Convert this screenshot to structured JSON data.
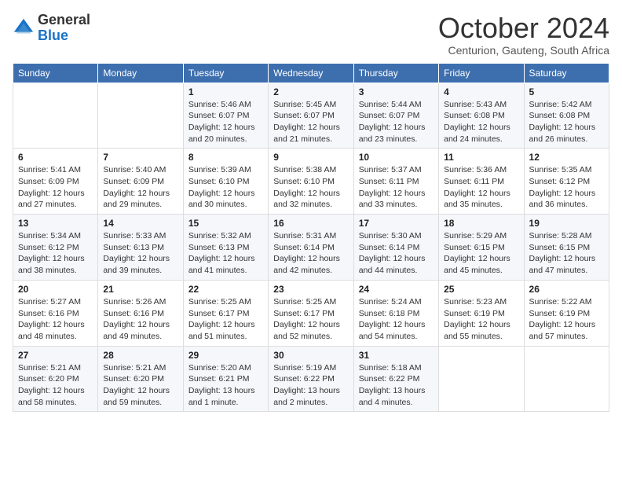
{
  "header": {
    "logo_general": "General",
    "logo_blue": "Blue",
    "month_title": "October 2024",
    "subtitle": "Centurion, Gauteng, South Africa"
  },
  "days_of_week": [
    "Sunday",
    "Monday",
    "Tuesday",
    "Wednesday",
    "Thursday",
    "Friday",
    "Saturday"
  ],
  "weeks": [
    [
      {
        "day": "",
        "sunrise": "",
        "sunset": "",
        "daylight": ""
      },
      {
        "day": "",
        "sunrise": "",
        "sunset": "",
        "daylight": ""
      },
      {
        "day": "1",
        "sunrise": "Sunrise: 5:46 AM",
        "sunset": "Sunset: 6:07 PM",
        "daylight": "Daylight: 12 hours and 20 minutes."
      },
      {
        "day": "2",
        "sunrise": "Sunrise: 5:45 AM",
        "sunset": "Sunset: 6:07 PM",
        "daylight": "Daylight: 12 hours and 21 minutes."
      },
      {
        "day": "3",
        "sunrise": "Sunrise: 5:44 AM",
        "sunset": "Sunset: 6:07 PM",
        "daylight": "Daylight: 12 hours and 23 minutes."
      },
      {
        "day": "4",
        "sunrise": "Sunrise: 5:43 AM",
        "sunset": "Sunset: 6:08 PM",
        "daylight": "Daylight: 12 hours and 24 minutes."
      },
      {
        "day": "5",
        "sunrise": "Sunrise: 5:42 AM",
        "sunset": "Sunset: 6:08 PM",
        "daylight": "Daylight: 12 hours and 26 minutes."
      }
    ],
    [
      {
        "day": "6",
        "sunrise": "Sunrise: 5:41 AM",
        "sunset": "Sunset: 6:09 PM",
        "daylight": "Daylight: 12 hours and 27 minutes."
      },
      {
        "day": "7",
        "sunrise": "Sunrise: 5:40 AM",
        "sunset": "Sunset: 6:09 PM",
        "daylight": "Daylight: 12 hours and 29 minutes."
      },
      {
        "day": "8",
        "sunrise": "Sunrise: 5:39 AM",
        "sunset": "Sunset: 6:10 PM",
        "daylight": "Daylight: 12 hours and 30 minutes."
      },
      {
        "day": "9",
        "sunrise": "Sunrise: 5:38 AM",
        "sunset": "Sunset: 6:10 PM",
        "daylight": "Daylight: 12 hours and 32 minutes."
      },
      {
        "day": "10",
        "sunrise": "Sunrise: 5:37 AM",
        "sunset": "Sunset: 6:11 PM",
        "daylight": "Daylight: 12 hours and 33 minutes."
      },
      {
        "day": "11",
        "sunrise": "Sunrise: 5:36 AM",
        "sunset": "Sunset: 6:11 PM",
        "daylight": "Daylight: 12 hours and 35 minutes."
      },
      {
        "day": "12",
        "sunrise": "Sunrise: 5:35 AM",
        "sunset": "Sunset: 6:12 PM",
        "daylight": "Daylight: 12 hours and 36 minutes."
      }
    ],
    [
      {
        "day": "13",
        "sunrise": "Sunrise: 5:34 AM",
        "sunset": "Sunset: 6:12 PM",
        "daylight": "Daylight: 12 hours and 38 minutes."
      },
      {
        "day": "14",
        "sunrise": "Sunrise: 5:33 AM",
        "sunset": "Sunset: 6:13 PM",
        "daylight": "Daylight: 12 hours and 39 minutes."
      },
      {
        "day": "15",
        "sunrise": "Sunrise: 5:32 AM",
        "sunset": "Sunset: 6:13 PM",
        "daylight": "Daylight: 12 hours and 41 minutes."
      },
      {
        "day": "16",
        "sunrise": "Sunrise: 5:31 AM",
        "sunset": "Sunset: 6:14 PM",
        "daylight": "Daylight: 12 hours and 42 minutes."
      },
      {
        "day": "17",
        "sunrise": "Sunrise: 5:30 AM",
        "sunset": "Sunset: 6:14 PM",
        "daylight": "Daylight: 12 hours and 44 minutes."
      },
      {
        "day": "18",
        "sunrise": "Sunrise: 5:29 AM",
        "sunset": "Sunset: 6:15 PM",
        "daylight": "Daylight: 12 hours and 45 minutes."
      },
      {
        "day": "19",
        "sunrise": "Sunrise: 5:28 AM",
        "sunset": "Sunset: 6:15 PM",
        "daylight": "Daylight: 12 hours and 47 minutes."
      }
    ],
    [
      {
        "day": "20",
        "sunrise": "Sunrise: 5:27 AM",
        "sunset": "Sunset: 6:16 PM",
        "daylight": "Daylight: 12 hours and 48 minutes."
      },
      {
        "day": "21",
        "sunrise": "Sunrise: 5:26 AM",
        "sunset": "Sunset: 6:16 PM",
        "daylight": "Daylight: 12 hours and 49 minutes."
      },
      {
        "day": "22",
        "sunrise": "Sunrise: 5:25 AM",
        "sunset": "Sunset: 6:17 PM",
        "daylight": "Daylight: 12 hours and 51 minutes."
      },
      {
        "day": "23",
        "sunrise": "Sunrise: 5:25 AM",
        "sunset": "Sunset: 6:17 PM",
        "daylight": "Daylight: 12 hours and 52 minutes."
      },
      {
        "day": "24",
        "sunrise": "Sunrise: 5:24 AM",
        "sunset": "Sunset: 6:18 PM",
        "daylight": "Daylight: 12 hours and 54 minutes."
      },
      {
        "day": "25",
        "sunrise": "Sunrise: 5:23 AM",
        "sunset": "Sunset: 6:19 PM",
        "daylight": "Daylight: 12 hours and 55 minutes."
      },
      {
        "day": "26",
        "sunrise": "Sunrise: 5:22 AM",
        "sunset": "Sunset: 6:19 PM",
        "daylight": "Daylight: 12 hours and 57 minutes."
      }
    ],
    [
      {
        "day": "27",
        "sunrise": "Sunrise: 5:21 AM",
        "sunset": "Sunset: 6:20 PM",
        "daylight": "Daylight: 12 hours and 58 minutes."
      },
      {
        "day": "28",
        "sunrise": "Sunrise: 5:21 AM",
        "sunset": "Sunset: 6:20 PM",
        "daylight": "Daylight: 12 hours and 59 minutes."
      },
      {
        "day": "29",
        "sunrise": "Sunrise: 5:20 AM",
        "sunset": "Sunset: 6:21 PM",
        "daylight": "Daylight: 13 hours and 1 minute."
      },
      {
        "day": "30",
        "sunrise": "Sunrise: 5:19 AM",
        "sunset": "Sunset: 6:22 PM",
        "daylight": "Daylight: 13 hours and 2 minutes."
      },
      {
        "day": "31",
        "sunrise": "Sunrise: 5:18 AM",
        "sunset": "Sunset: 6:22 PM",
        "daylight": "Daylight: 13 hours and 4 minutes."
      },
      {
        "day": "",
        "sunrise": "",
        "sunset": "",
        "daylight": ""
      },
      {
        "day": "",
        "sunrise": "",
        "sunset": "",
        "daylight": ""
      }
    ]
  ]
}
